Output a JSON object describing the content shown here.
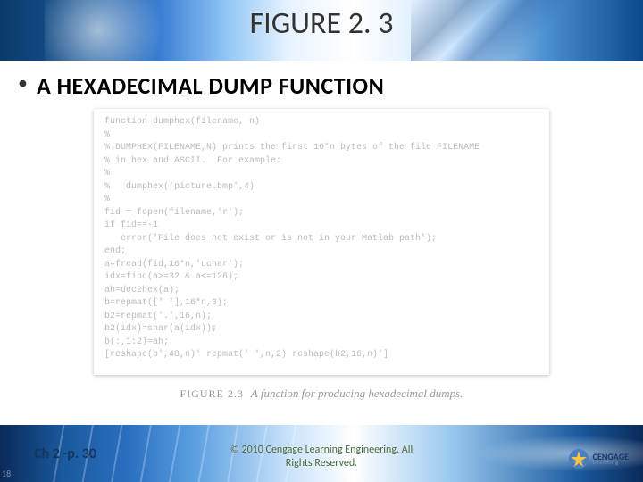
{
  "title": "FIGURE 2. 3",
  "bullet": "A HEXADECIMAL DUMP FUNCTION",
  "code_lines": "function dumphex(filename, n)\n%\n% DUMPHEX(FILENAME,N) prints the first 16*n bytes of the file FILENAME\n% in hex and ASCII.  For example:\n%\n%   dumphex('picture.bmp',4)\n%\nfid = fopen(filename,'r');\nif fid==-1\n   error('File does not exist or is not in your Matlab path');\nend;\na=fread(fid,16*n,'uchar');\nidx=find(a>=32 & a<=126);\nah=dec2hex(a);\nb=repmat([' '],16*n,3);\nb2=repmat('.',16,n);\nb2(idx)=char(a(idx));\nb(:,1:2)=ah;\n[reshape(b',48,n)' repmat(' ',n,2) reshape(b2,16,n)']",
  "caption_label": "FIGURE 2.3",
  "caption_text": "A function for producing hexadecimal dumps.",
  "slide_number": "18",
  "page_ref": "Ch 2 -p. 30",
  "copyright_line1": "© 2010 Cengage Learning Engineering. All",
  "copyright_line2": "Rights Reserved.",
  "logo_main": "CENGAGE",
  "logo_sub": "Learning"
}
